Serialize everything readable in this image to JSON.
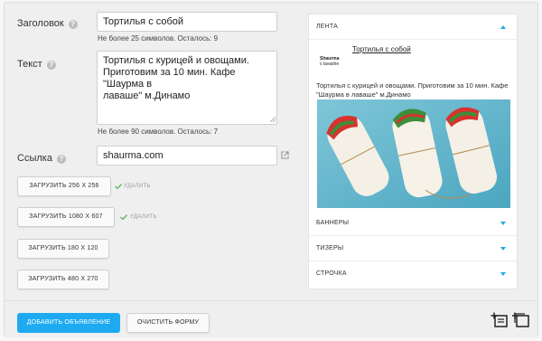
{
  "form": {
    "title_label": "Заголовок",
    "title_value": "Тортилья с собой",
    "title_hint": "Не более 25 символов. Осталось: 9",
    "text_label": "Текст",
    "text_value": "Тортилья с курицей и овощами.\nПриготовим за 10 мин. Кафе \"Шаурма в\nлаваше\" м.Динамо",
    "text_hint": "Не более 90 символов. Осталось: 7",
    "link_label": "Ссылка",
    "link_value": "shaurma.com",
    "upload_buttons": [
      {
        "label": "ЗАГРУЗИТЬ 256 X 256",
        "uploaded": true,
        "delete_label": "УДАЛИТЬ"
      },
      {
        "label": "ЗАГРУЗИТЬ 1080 X 607",
        "uploaded": true,
        "delete_label": "УДАЛИТЬ"
      },
      {
        "label": "ЗАГРУЗИТЬ 180 X 120",
        "uploaded": false
      },
      {
        "label": "ЗАГРУЗИТЬ 480 X 270",
        "uploaded": false
      }
    ],
    "help_glyph": "?"
  },
  "preview": {
    "sections": [
      {
        "label": "ЛЕНТА",
        "expanded": true
      },
      {
        "label": "БАННЕРЫ",
        "expanded": false
      },
      {
        "label": "ТИЗЕРЫ",
        "expanded": false
      },
      {
        "label": "СТРОЧКА",
        "expanded": false
      }
    ],
    "logo_line1": "Shaurma",
    "logo_line2": "v lavashe",
    "ad_title": "Тортилья с собой",
    "ad_text": "Тортилья с курицей и овощами. Приготовим за 10 мин. Кафе \"Шаурма в лаваше\" м.Динамо"
  },
  "footer": {
    "add_button": "ДОБАВИТЬ ОБЪЯВЛЕНИЕ",
    "clear_button": "ОЧИСТИТЬ ФОРМУ"
  },
  "colors": {
    "accent": "#1eaaf1",
    "check": "#4caf50",
    "image_bg": "#6ab7cf"
  },
  "icons": [
    "help-icon",
    "external-link-icon",
    "check-icon",
    "caret-up-icon",
    "caret-down-icon",
    "add-ad-icon",
    "copy-ad-icon"
  ]
}
